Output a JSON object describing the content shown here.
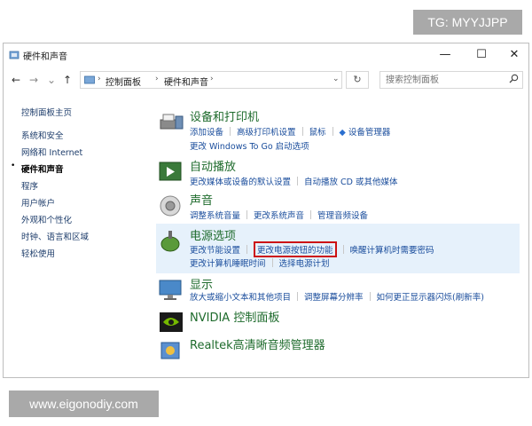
{
  "watermarks": {
    "top": "TG: MYYJJPP",
    "bottom": "www.eigonodiy.com"
  },
  "window": {
    "title": "硬件和声音",
    "controls": {
      "minimize": "—",
      "maximize": "☐",
      "close": "✕"
    }
  },
  "navbar": {
    "back": "←",
    "forward": "→",
    "recent": "⌄",
    "up": "↑",
    "breadcrumb": [
      "控制面板",
      "硬件和声音"
    ],
    "refresh": "↻",
    "search_placeholder": "搜索控制面板",
    "search_icon": "search-icon"
  },
  "sidebar": {
    "items": [
      {
        "label": "控制面板主页",
        "active": false
      },
      {
        "label": "系统和安全",
        "active": false
      },
      {
        "label": "网络和 Internet",
        "active": false
      },
      {
        "label": "硬件和声音",
        "active": true
      },
      {
        "label": "程序",
        "active": false
      },
      {
        "label": "用户帐户",
        "active": false
      },
      {
        "label": "外观和个性化",
        "active": false
      },
      {
        "label": "时钟、语言和区域",
        "active": false
      },
      {
        "label": "轻松使用",
        "active": false
      }
    ]
  },
  "categories": [
    {
      "title": "设备和打印机",
      "icon": "printer-icon",
      "links": [
        "添加设备",
        "高级打印机设置",
        "鼠标",
        "设备管理器"
      ],
      "links2": [
        "更改 Windows To Go 启动选项"
      ]
    },
    {
      "title": "自动播放",
      "icon": "autoplay-icon",
      "links": [
        "更改媒体或设备的默认设置",
        "自动播放 CD 或其他媒体"
      ]
    },
    {
      "title": "声音",
      "icon": "speaker-icon",
      "links": [
        "调整系统音量",
        "更改系统声音",
        "管理音频设备"
      ]
    },
    {
      "title": "电源选项",
      "icon": "power-icon",
      "links": [
        "更改节能设置",
        "更改电源按钮的功能",
        "唤醒计算机时需要密码"
      ],
      "links2": [
        "更改计算机睡眠时间",
        "选择电源计划"
      ]
    },
    {
      "title": "显示",
      "icon": "display-icon",
      "links": [
        "放大或缩小文本和其他项目",
        "调整屏幕分辨率",
        "如何更正显示器闪烁(刷新率)"
      ]
    },
    {
      "title": "NVIDIA 控制面板",
      "icon": "nvidia-icon"
    },
    {
      "title": "Realtek高清晰音频管理器",
      "icon": "realtek-icon"
    }
  ],
  "colors": {
    "category_title": "#1e6b2c",
    "link": "#1a4d9c",
    "highlight": "#e6f1fb",
    "red_box": "#cc1111"
  }
}
